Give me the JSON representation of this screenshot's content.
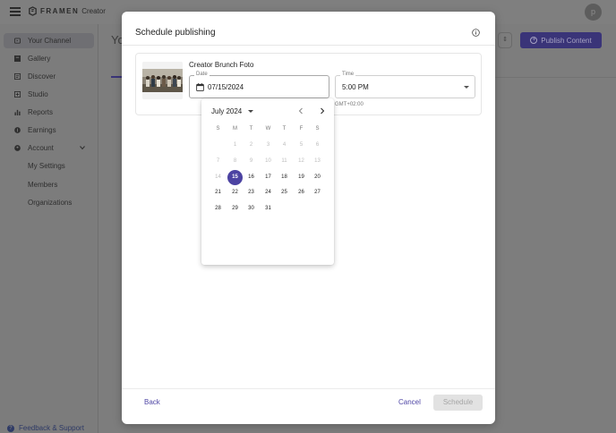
{
  "app": {
    "brand": "FRAMEN",
    "brand_sub": "Creator",
    "avatar_initial": "p"
  },
  "sidebar": {
    "items": [
      {
        "label": "Your Channel",
        "icon": "channel-icon"
      },
      {
        "label": "Gallery",
        "icon": "gallery-icon"
      },
      {
        "label": "Discover",
        "icon": "discover-icon"
      },
      {
        "label": "Studio",
        "icon": "studio-icon"
      },
      {
        "label": "Reports",
        "icon": "reports-icon"
      },
      {
        "label": "Earnings",
        "icon": "earnings-icon"
      },
      {
        "label": "Account",
        "icon": "account-icon"
      },
      {
        "label": "My Settings"
      },
      {
        "label": "Members"
      },
      {
        "label": "Organizations"
      }
    ],
    "feedback_label": "Feedback & Support"
  },
  "background": {
    "page_title_fragment": "Yo",
    "publish_button": "Publish Content"
  },
  "modal": {
    "title": "Schedule publishing",
    "content_title": "Creator Brunch Foto",
    "date_label": "Date",
    "date_value": "07/15/2024",
    "time_label": "Time",
    "time_value": "5:00 PM",
    "timezone": "GMT+02:00",
    "back_label": "Back",
    "cancel_label": "Cancel",
    "schedule_label": "Schedule"
  },
  "datepicker": {
    "month_label": "July 2024",
    "weekdays": [
      "S",
      "M",
      "T",
      "W",
      "T",
      "F",
      "S"
    ],
    "first_weekday_offset": 1,
    "days_in_month": 31,
    "selected_day": 15,
    "last_disabled_day": 14
  },
  "colors": {
    "accent": "#4c43a2",
    "overlay": "#7d7d7d"
  }
}
